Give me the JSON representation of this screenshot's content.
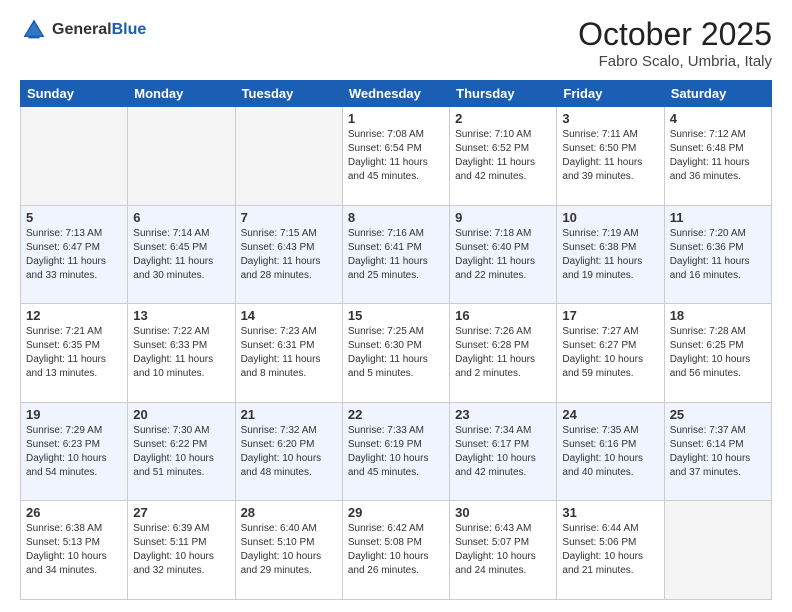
{
  "header": {
    "logo_general": "General",
    "logo_blue": "Blue",
    "month_title": "October 2025",
    "location": "Fabro Scalo, Umbria, Italy"
  },
  "weekdays": [
    "Sunday",
    "Monday",
    "Tuesday",
    "Wednesday",
    "Thursday",
    "Friday",
    "Saturday"
  ],
  "weeks": [
    [
      {
        "day": "",
        "info": ""
      },
      {
        "day": "",
        "info": ""
      },
      {
        "day": "",
        "info": ""
      },
      {
        "day": "1",
        "info": "Sunrise: 7:08 AM\nSunset: 6:54 PM\nDaylight: 11 hours and 45 minutes."
      },
      {
        "day": "2",
        "info": "Sunrise: 7:10 AM\nSunset: 6:52 PM\nDaylight: 11 hours and 42 minutes."
      },
      {
        "day": "3",
        "info": "Sunrise: 7:11 AM\nSunset: 6:50 PM\nDaylight: 11 hours and 39 minutes."
      },
      {
        "day": "4",
        "info": "Sunrise: 7:12 AM\nSunset: 6:48 PM\nDaylight: 11 hours and 36 minutes."
      }
    ],
    [
      {
        "day": "5",
        "info": "Sunrise: 7:13 AM\nSunset: 6:47 PM\nDaylight: 11 hours and 33 minutes."
      },
      {
        "day": "6",
        "info": "Sunrise: 7:14 AM\nSunset: 6:45 PM\nDaylight: 11 hours and 30 minutes."
      },
      {
        "day": "7",
        "info": "Sunrise: 7:15 AM\nSunset: 6:43 PM\nDaylight: 11 hours and 28 minutes."
      },
      {
        "day": "8",
        "info": "Sunrise: 7:16 AM\nSunset: 6:41 PM\nDaylight: 11 hours and 25 minutes."
      },
      {
        "day": "9",
        "info": "Sunrise: 7:18 AM\nSunset: 6:40 PM\nDaylight: 11 hours and 22 minutes."
      },
      {
        "day": "10",
        "info": "Sunrise: 7:19 AM\nSunset: 6:38 PM\nDaylight: 11 hours and 19 minutes."
      },
      {
        "day": "11",
        "info": "Sunrise: 7:20 AM\nSunset: 6:36 PM\nDaylight: 11 hours and 16 minutes."
      }
    ],
    [
      {
        "day": "12",
        "info": "Sunrise: 7:21 AM\nSunset: 6:35 PM\nDaylight: 11 hours and 13 minutes."
      },
      {
        "day": "13",
        "info": "Sunrise: 7:22 AM\nSunset: 6:33 PM\nDaylight: 11 hours and 10 minutes."
      },
      {
        "day": "14",
        "info": "Sunrise: 7:23 AM\nSunset: 6:31 PM\nDaylight: 11 hours and 8 minutes."
      },
      {
        "day": "15",
        "info": "Sunrise: 7:25 AM\nSunset: 6:30 PM\nDaylight: 11 hours and 5 minutes."
      },
      {
        "day": "16",
        "info": "Sunrise: 7:26 AM\nSunset: 6:28 PM\nDaylight: 11 hours and 2 minutes."
      },
      {
        "day": "17",
        "info": "Sunrise: 7:27 AM\nSunset: 6:27 PM\nDaylight: 10 hours and 59 minutes."
      },
      {
        "day": "18",
        "info": "Sunrise: 7:28 AM\nSunset: 6:25 PM\nDaylight: 10 hours and 56 minutes."
      }
    ],
    [
      {
        "day": "19",
        "info": "Sunrise: 7:29 AM\nSunset: 6:23 PM\nDaylight: 10 hours and 54 minutes."
      },
      {
        "day": "20",
        "info": "Sunrise: 7:30 AM\nSunset: 6:22 PM\nDaylight: 10 hours and 51 minutes."
      },
      {
        "day": "21",
        "info": "Sunrise: 7:32 AM\nSunset: 6:20 PM\nDaylight: 10 hours and 48 minutes."
      },
      {
        "day": "22",
        "info": "Sunrise: 7:33 AM\nSunset: 6:19 PM\nDaylight: 10 hours and 45 minutes."
      },
      {
        "day": "23",
        "info": "Sunrise: 7:34 AM\nSunset: 6:17 PM\nDaylight: 10 hours and 42 minutes."
      },
      {
        "day": "24",
        "info": "Sunrise: 7:35 AM\nSunset: 6:16 PM\nDaylight: 10 hours and 40 minutes."
      },
      {
        "day": "25",
        "info": "Sunrise: 7:37 AM\nSunset: 6:14 PM\nDaylight: 10 hours and 37 minutes."
      }
    ],
    [
      {
        "day": "26",
        "info": "Sunrise: 6:38 AM\nSunset: 5:13 PM\nDaylight: 10 hours and 34 minutes."
      },
      {
        "day": "27",
        "info": "Sunrise: 6:39 AM\nSunset: 5:11 PM\nDaylight: 10 hours and 32 minutes."
      },
      {
        "day": "28",
        "info": "Sunrise: 6:40 AM\nSunset: 5:10 PM\nDaylight: 10 hours and 29 minutes."
      },
      {
        "day": "29",
        "info": "Sunrise: 6:42 AM\nSunset: 5:08 PM\nDaylight: 10 hours and 26 minutes."
      },
      {
        "day": "30",
        "info": "Sunrise: 6:43 AM\nSunset: 5:07 PM\nDaylight: 10 hours and 24 minutes."
      },
      {
        "day": "31",
        "info": "Sunrise: 6:44 AM\nSunset: 5:06 PM\nDaylight: 10 hours and 21 minutes."
      },
      {
        "day": "",
        "info": ""
      }
    ]
  ]
}
